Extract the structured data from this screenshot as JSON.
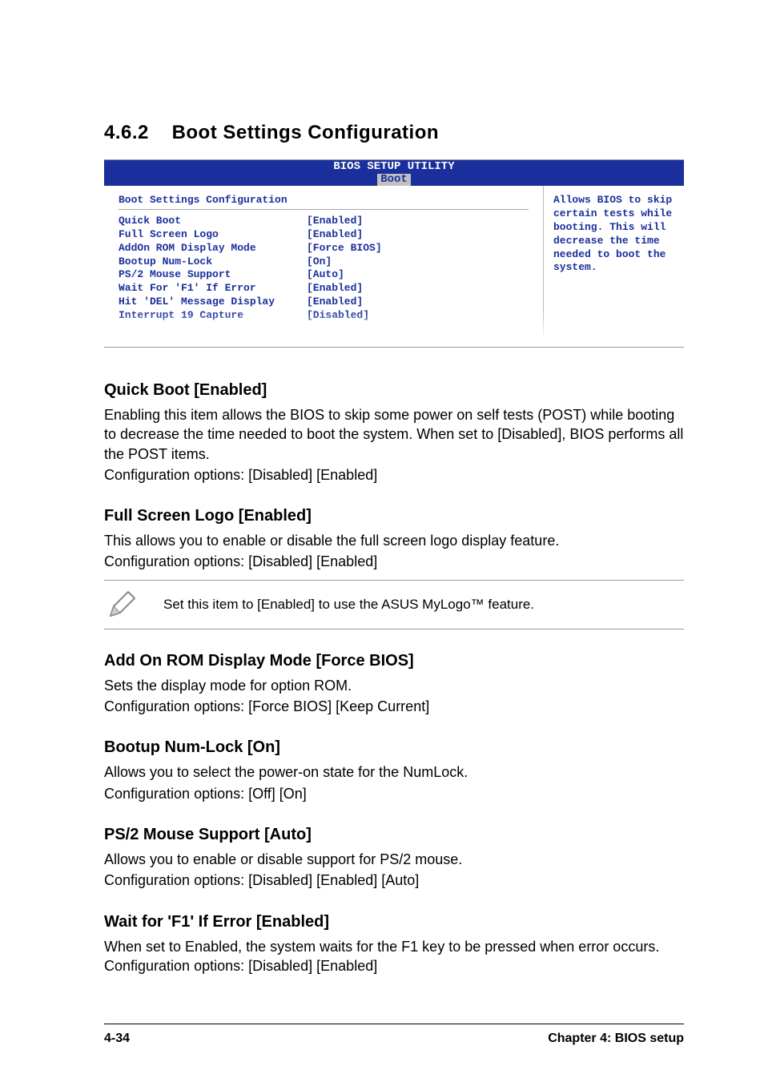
{
  "section": {
    "number": "4.6.2",
    "title": "Boot Settings Configuration"
  },
  "bios": {
    "utilTitle": "BIOS SETUP UTILITY",
    "tab": "Boot",
    "panelTitle": "Boot Settings Configuration",
    "help": "Allows BIOS to skip certain tests while booting. This will decrease the time needed to boot the system.",
    "rows": [
      {
        "label": "Quick Boot",
        "value": "[Enabled]"
      },
      {
        "label": "Full Screen Logo",
        "value": "[Enabled]"
      },
      {
        "label": "AddOn ROM Display Mode",
        "value": "[Force BIOS]"
      },
      {
        "label": "Bootup Num-Lock",
        "value": "[On]"
      },
      {
        "label": "PS/2 Mouse Support",
        "value": "[Auto]"
      },
      {
        "label": "Wait For 'F1' If Error",
        "value": "[Enabled]"
      },
      {
        "label": "Hit 'DEL' Message Display",
        "value": "[Enabled]"
      },
      {
        "label": "Interrupt 19 Capture",
        "value": "[Disabled]"
      }
    ]
  },
  "items": {
    "quickBoot": {
      "heading": "Quick Boot [Enabled]",
      "p1": "Enabling this item allows the BIOS to skip some power on self tests (POST) while booting to decrease the time needed to boot the system. When set to [Disabled], BIOS performs all the POST items.",
      "p2": "Configuration options: [Disabled] [Enabled]"
    },
    "fullScreen": {
      "heading": "Full Screen Logo [Enabled]",
      "p1": "This allows you to enable or disable the full screen logo display feature.",
      "p2": "Configuration options: [Disabled] [Enabled]"
    },
    "note": "Set this item to [Enabled] to use the ASUS MyLogo™ feature.",
    "addOnRom": {
      "heading": "Add On ROM Display Mode [Force BIOS]",
      "p1": "Sets the display mode for option ROM.",
      "p2": "Configuration options: [Force BIOS] [Keep Current]"
    },
    "numLock": {
      "heading": "Bootup Num-Lock [On]",
      "p1": "Allows you to select the power-on state for the NumLock.",
      "p2": "Configuration options: [Off] [On]"
    },
    "ps2": {
      "heading": "PS/2 Mouse Support [Auto]",
      "p1": "Allows you to enable or disable support for PS/2 mouse.",
      "p2": "Configuration options: [Disabled] [Enabled] [Auto]"
    },
    "waitF1": {
      "heading": "Wait for 'F1' If Error [Enabled]",
      "p1": "When set to Enabled, the system waits for the F1 key to be pressed when error occurs. Configuration options: [Disabled] [Enabled]"
    }
  },
  "footer": {
    "page": "4-34",
    "chapter": "Chapter 4: BIOS setup"
  }
}
